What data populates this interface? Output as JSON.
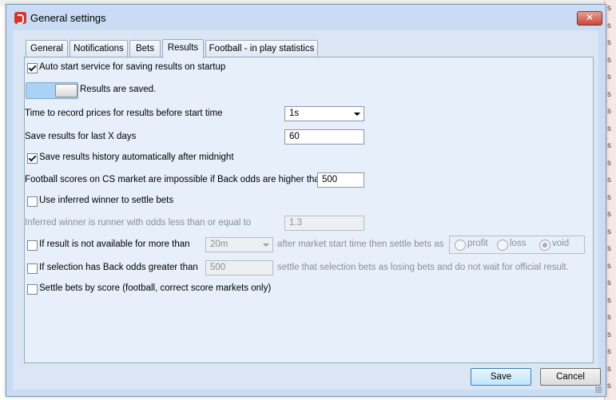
{
  "window": {
    "title": "General settings",
    "close_label": "✕"
  },
  "tabs": [
    {
      "label": "General"
    },
    {
      "label": "Notifications"
    },
    {
      "label": "Bets"
    },
    {
      "label": "Results"
    },
    {
      "label": "Football - in play statistics"
    }
  ],
  "active_tab": "Results",
  "results": {
    "auto_start": {
      "label": "Auto start service for saving results on startup",
      "checked": true
    },
    "saved_toggle": {
      "label": "Results are saved.",
      "on": true
    },
    "time_to_record": {
      "label": "Time to record prices for results before start time",
      "value": "1s"
    },
    "save_days": {
      "label": "Save results for last X days",
      "value": "60"
    },
    "save_history": {
      "label": "Save results history automatically after midnight",
      "checked": true
    },
    "cs_impossible": {
      "label": "Football scores on CS market are impossible if Back odds are higher than",
      "value": "500"
    },
    "use_inferred": {
      "label": "Use inferred winner to settle bets",
      "checked": false
    },
    "inferred_odds": {
      "label": "Inferred winner is runner with odds less than or equal to",
      "value": "1.3"
    },
    "not_available": {
      "label": "If result is not available for more than",
      "value": "20m",
      "suffix": "after market start time then settle bets as",
      "checked": false,
      "options": [
        "profit",
        "loss",
        "void"
      ],
      "selected": "void"
    },
    "back_odds_greater": {
      "label": "If selection has Back odds greater than",
      "value": "500",
      "suffix": "settle that selection bets as losing bets and do not wait for official result.",
      "checked": false
    },
    "settle_by_score": {
      "label": "Settle bets by score (football, correct score markets only)",
      "checked": false
    }
  },
  "buttons": {
    "save": "Save",
    "cancel": "Cancel"
  },
  "background": {
    "side_letters": [
      "s",
      "s",
      "s",
      "s",
      "s",
      "s",
      "s",
      "s",
      "s",
      "s",
      "s",
      "s",
      "s",
      "s",
      "s",
      "s",
      "s",
      "s",
      "s",
      "s",
      "s",
      "s",
      "s"
    ]
  }
}
